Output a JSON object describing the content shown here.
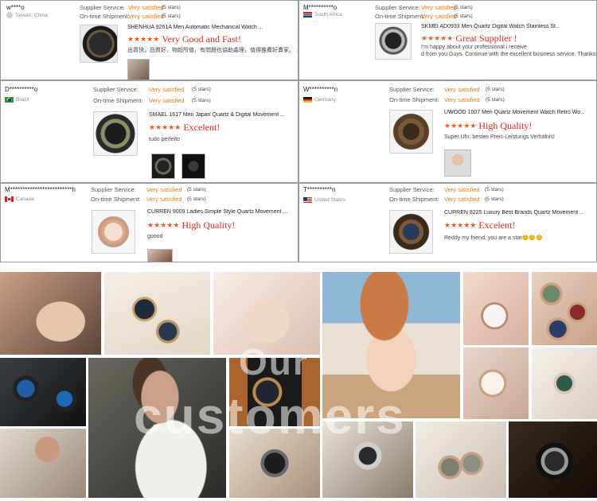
{
  "labels": {
    "supplier_service": "Supplier Service:",
    "ontime_shipment": "On-time Shipment:"
  },
  "rating_stars": "★★★★★",
  "reviews": [
    {
      "user": "w****o",
      "country": "Taiwan, China",
      "supplier_value": "Very satisfied",
      "supplier_stars": "(5 stars)",
      "shipment_value": "Very satisfied",
      "shipment_stars": "(5 stars)",
      "product": "SHENHUA 9261A Men Automatic Mechanical Watch ...",
      "rating_text": "Very Good and Fast!",
      "comment": "出貨快，品質好，物超所值，有問題也協助處理，值得推薦好賣家。 👍"
    },
    {
      "user": "M**********o",
      "country": "South Africa",
      "supplier_value": "Very satisfied",
      "supplier_stars": "(5 stars)",
      "shipment_value": "Very satisfied",
      "shipment_stars": "(5 stars)",
      "product": "SKMEI AD0933 Men Quartz Digital Watch Stainless St...",
      "rating_text": "Great Supplier !",
      "comment": "I'm happy about your professional  i receive",
      "comment2": "d from you Guys. Continue with the excellent business service. Thanks 👍👍"
    },
    {
      "user": "D**********o",
      "country": "Brazil",
      "supplier_value": "Very satisfied",
      "supplier_stars": "(5 stars)",
      "shipment_value": "Very satisfied",
      "shipment_stars": "(5 stars)",
      "product": "SMAEL 1617 Men Japan Quartz & Digital Movement ...",
      "rating_text": "Excelent!",
      "comment": "tudo perfeito"
    },
    {
      "user": "W**********n",
      "country": "Germany",
      "supplier_value": "Very satisfied",
      "supplier_stars": "(5 stars)",
      "shipment_value": "Very satisfied",
      "shipment_stars": "(5 stars)",
      "product": "UWOOD 1007 Men Quartz Movement Watch Retro Wo...",
      "rating_text": "High Quality!",
      "comment": "Super Uhr, bestes Preis-Leistungs Verhälnis!"
    },
    {
      "user": "M*************************h",
      "country": "Canada",
      "supplier_value": "Very satisfied",
      "supplier_stars": "(5 stars)",
      "shipment_value": "Very satisfied",
      "shipment_stars": "(5 stars)",
      "product": "CURREN 9009 Ladies Simple Style Quartz Movement ...",
      "rating_text": "High Quality!",
      "comment": "goood"
    },
    {
      "user": "T**********n",
      "country": "United States",
      "supplier_value": "Very satisfied",
      "supplier_stars": "(5 stars)",
      "shipment_value": "Very satisfied",
      "shipment_stars": "(5 stars)",
      "product": "CURREN 8225 Luxury Best Brands Quartz Movement ...",
      "rating_text": "Excelent!",
      "comment": "Reddy my friend, you are a star😊😊😊"
    }
  ],
  "gallery": {
    "overlay_line1": "Our",
    "overlay_line2": "customers"
  },
  "colors": {
    "accent_orange": "#f07a0a",
    "rating_red": "#e8231b",
    "star_orange": "#f25a1b"
  }
}
